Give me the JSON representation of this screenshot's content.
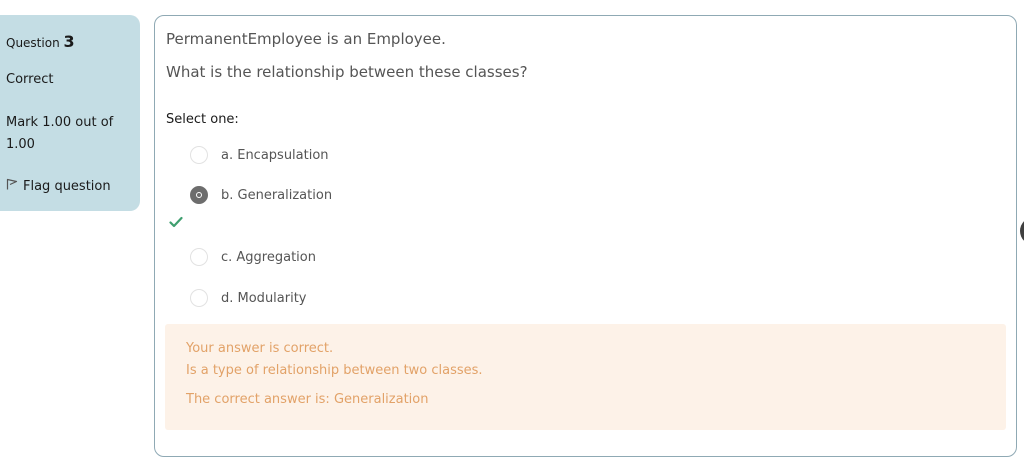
{
  "info": {
    "question_label": "Question",
    "question_number": "3",
    "state": "Correct",
    "grade": "Mark 1.00 out of 1.00",
    "flag_label": "Flag question"
  },
  "question": {
    "text_line1": "PermanentEmployee is an Employee.",
    "text_line2": "What is the relationship between these classes?",
    "prompt": "Select one:",
    "options": [
      {
        "label": "a. Encapsulation",
        "selected": false
      },
      {
        "label": "b. Generalization",
        "selected": true,
        "correct": true
      },
      {
        "label": "c. Aggregation",
        "selected": false
      },
      {
        "label": "d. Modularity",
        "selected": false
      }
    ]
  },
  "feedback": {
    "result": "Your answer is correct.",
    "general": "Is a type of relationship between two classes.",
    "right_answer": "The correct answer is: Generalization"
  },
  "colors": {
    "info_panel": "#c4dde4",
    "feedback_bg": "#fdf2e8",
    "feedback_text": "#e2a268",
    "correct_check": "#3f9f6f",
    "content_border": "#8fa9b4"
  }
}
